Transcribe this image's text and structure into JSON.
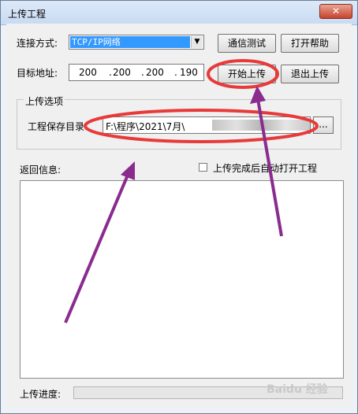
{
  "window": {
    "title": "上传工程",
    "close_label": "✕"
  },
  "connection": {
    "label": "连接方式:",
    "selected": "TCP/IP网络"
  },
  "buttons": {
    "comm_test": "通信测试",
    "open_help": "打开帮助",
    "start_upload": "开始上传",
    "exit_upload": "退出上传",
    "browse": "..."
  },
  "target": {
    "label": "目标地址:",
    "ip": [
      "200",
      "200",
      "200",
      "190"
    ]
  },
  "upload_options": {
    "group_label": "上传选项",
    "save_dir_label": "工程保存目录:",
    "save_dir_value": "F:\\程序\\2021\\7月\\"
  },
  "return_info": {
    "label": "返回信息:"
  },
  "auto_open": {
    "label": "上传完成后自动打开工程",
    "checked": false
  },
  "progress": {
    "label": "上传进度:",
    "value": 0
  },
  "watermark": {
    "text": "Baidu 经验"
  },
  "annotation_color": "#e83a3a",
  "arrow_color": "#8a2c8e"
}
